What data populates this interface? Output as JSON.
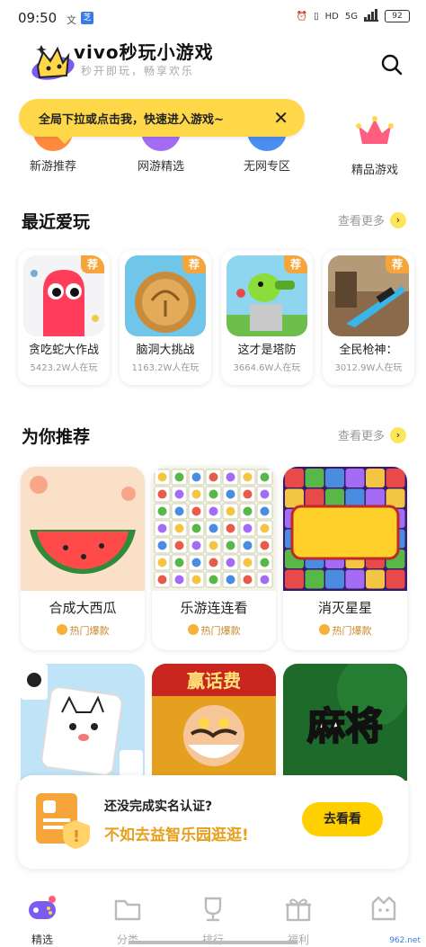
{
  "status": {
    "time": "09:50",
    "ind1": "文",
    "ind2": "芝",
    "net": "HD",
    "sig": "5G",
    "battery": "92"
  },
  "header": {
    "title": "vivo秒玩小游戏",
    "subtitle": "秒开即玩，畅享欢乐"
  },
  "tooltip": {
    "text": "全局下拉或点击我，快速进入游戏~",
    "close": "✕"
  },
  "categories": [
    {
      "label": "新游推荐"
    },
    {
      "label": "网游精选"
    },
    {
      "label": "无网专区"
    },
    {
      "label": "精品游戏"
    }
  ],
  "recent": {
    "title": "最近爱玩",
    "more": "查看更多",
    "items": [
      {
        "name": "贪吃蛇大作战",
        "players": "5423.2W人在玩",
        "tag": "荐"
      },
      {
        "name": "脑洞大挑战",
        "players": "1163.2W人在玩",
        "tag": "荐"
      },
      {
        "name": "这才是塔防",
        "players": "3664.6W人在玩",
        "tag": "荐"
      },
      {
        "name": "全民枪神：",
        "players": "3012.9W人在玩",
        "tag": "荐"
      }
    ]
  },
  "recommend": {
    "title": "为你推荐",
    "more": "查看更多",
    "items": [
      {
        "name": "合成大西瓜",
        "badge": "热门爆款"
      },
      {
        "name": "乐游连连看",
        "badge": "热门爆款"
      },
      {
        "name": "消灭星星",
        "badge": "热门爆款"
      }
    ],
    "row2": [
      {
        "art": "cat-mahjong"
      },
      {
        "art": "赢话费"
      },
      {
        "art": "麻将"
      }
    ]
  },
  "banner": {
    "line1": "还没完成实名认证?",
    "line2": "不如去益智乐园逛逛!",
    "button": "去看看"
  },
  "tabs": [
    {
      "label": "精选",
      "active": true
    },
    {
      "label": "分类",
      "active": false
    },
    {
      "label": "排行",
      "active": false
    },
    {
      "label": "福利",
      "active": false
    },
    {
      "label": "",
      "active": false
    }
  ],
  "watermark": "962.net",
  "colors": {
    "accent": "#ffd84a",
    "tag": "#f6a53a",
    "hot": "#c98a2c",
    "active_tab": "#7b5cf0"
  }
}
